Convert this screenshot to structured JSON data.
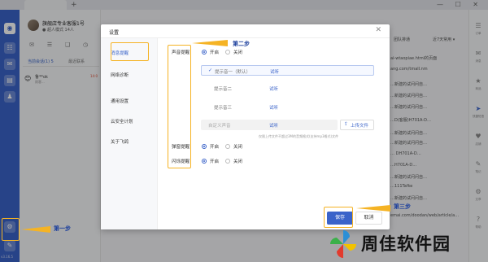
{
  "window": {
    "new_tab": "+",
    "controls": "— ☐ ✕"
  },
  "user": {
    "name": "旗舰店专业客服1号",
    "status": "● 超人模式 14人"
  },
  "conv_tabs": {
    "current": "当前会话(1)  5",
    "recent": "最近联系"
  },
  "conversation": {
    "emoji": "😊",
    "name": "鲁**ok",
    "time": "14:0",
    "preview": "顾客..."
  },
  "rail": {
    "version": "v3.16.5"
  },
  "main_header": {
    "mode": "团队排通",
    "filter": "近7天常用 ▾"
  },
  "background_lines": [
    "ai-wtaopiae.html的页面",
    "ang.com/tmall.nm",
    "…新建的试问问自…",
    "…新建的试问问自…",
    "…新建的试问问自…",
    "…D(客服)H701A-D…",
    "…新建的试问问自…",
    "…新建的试问问自…",
    "… DH701A-D…",
    "…H701A-D…",
    "…新建的试问问自…",
    "…111Tafke",
    "…新建的试问问自…",
    "emai.com/doodan/web/article/a…"
  ],
  "right_bar": [
    {
      "icon": "☰",
      "label": "订单"
    },
    {
      "icon": "✉",
      "label": "消息"
    },
    {
      "icon": "★",
      "label": "商品"
    },
    {
      "icon": "➤",
      "label": "快捷短语"
    },
    {
      "icon": "♥",
      "label": "店铺"
    },
    {
      "icon": "✎",
      "label": "笔记"
    },
    {
      "icon": "⚙",
      "label": "文章"
    },
    {
      "icon": "?",
      "label": "帮助"
    }
  ],
  "dialog": {
    "title": "设置",
    "close": "✕",
    "nav": [
      {
        "label": "消息提醒",
        "active": true
      },
      {
        "label": "网络诊断",
        "active": false
      },
      {
        "label": "通用设置",
        "active": false
      },
      {
        "label": "云安全计划",
        "active": false
      },
      {
        "label": "关于飞鸽",
        "active": false
      }
    ],
    "sound_label": "声音提醒",
    "on_label": "开启",
    "off_label": "关闭",
    "sounds": [
      {
        "name": "提示音一（默认）",
        "try": "试听",
        "selected": true
      },
      {
        "name": "提示音二",
        "try": "试听",
        "selected": false
      },
      {
        "name": "提示音三",
        "try": "试听",
        "selected": false
      }
    ],
    "check": "✓",
    "custom": {
      "placeholder": "自定义声音",
      "try": "试听",
      "upload": "上传文件",
      "upload_icon": "⇪",
      "hint": "仅限上传文件不超过3M的音频格式(支持mp3格式)文件"
    },
    "popup_label": "弹窗提醒",
    "flash_label": "闪烁提醒",
    "save": "保存",
    "cancel": "取消"
  },
  "annotations": {
    "step1": "第一步",
    "step2": "第二步",
    "step3": "第三步"
  },
  "watermark": {
    "text": "周佳软件园"
  },
  "colors": {
    "accent": "#3a63c9",
    "annotation": "#f5b324",
    "annotation_text": "#1b3e9c"
  }
}
